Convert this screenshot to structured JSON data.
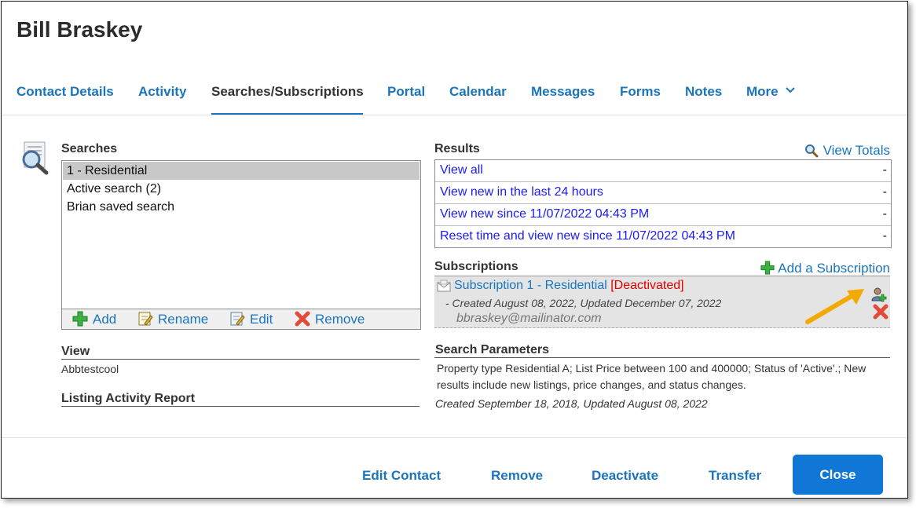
{
  "contact": {
    "name": "Bill Braskey"
  },
  "tabs": [
    {
      "label": "Contact Details"
    },
    {
      "label": "Activity"
    },
    {
      "label": "Searches/Subscriptions",
      "active": true
    },
    {
      "label": "Portal"
    },
    {
      "label": "Calendar"
    },
    {
      "label": "Messages"
    },
    {
      "label": "Forms"
    },
    {
      "label": "Notes"
    },
    {
      "label": "More"
    }
  ],
  "searches": {
    "heading": "Searches",
    "items": [
      {
        "label": "1 - Residential",
        "selected": true
      },
      {
        "label": "Active search (2)"
      },
      {
        "label": "Brian saved search"
      }
    ],
    "toolbar": {
      "add": "Add",
      "rename": "Rename",
      "edit": "Edit",
      "remove": "Remove"
    }
  },
  "view": {
    "heading": "View",
    "value": "Abbtestcool"
  },
  "listing_report": {
    "heading": "Listing Activity Report"
  },
  "results": {
    "heading": "Results",
    "view_totals": "View Totals",
    "rows": [
      {
        "label": "View all",
        "value": "-"
      },
      {
        "label": "View new in the last 24 hours",
        "value": "-"
      },
      {
        "label": "View new since 11/07/2022 04:43 PM",
        "value": "-"
      },
      {
        "label": "Reset time and view new since 11/07/2022 04:43 PM",
        "value": "-"
      }
    ]
  },
  "subscriptions": {
    "heading": "Subscriptions",
    "add_label": "Add a Subscription",
    "item": {
      "name": "Subscription 1 - Residential",
      "status": "[Deactivated]",
      "dates": "- Created August 08, 2022, Updated December 07, 2022",
      "email": "bbraskey@mailinator.com"
    }
  },
  "search_parameters": {
    "heading": "Search Parameters",
    "text": "Property type Residential A; List Price between 100 and 400000; Status of 'Active'.; New results include new listings, price changes, and status changes.",
    "dates": "Created September 18, 2018, Updated August 08, 2022"
  },
  "footer": {
    "edit_contact": "Edit Contact",
    "remove": "Remove",
    "deactivate": "Deactivate",
    "transfer": "Transfer",
    "close": "Close"
  },
  "colors": {
    "link": "#1b75bc",
    "primary_button": "#1077d6",
    "deactivated": "#e00000",
    "annotation_arrow": "#f2a900"
  },
  "icons": [
    "search-list-icon",
    "add-icon",
    "rename-icon",
    "edit-icon",
    "remove-icon",
    "magnifier-icon",
    "subscription-envelope-icon",
    "add-recipient-icon",
    "delete-subscription-icon",
    "chevron-down-icon"
  ]
}
